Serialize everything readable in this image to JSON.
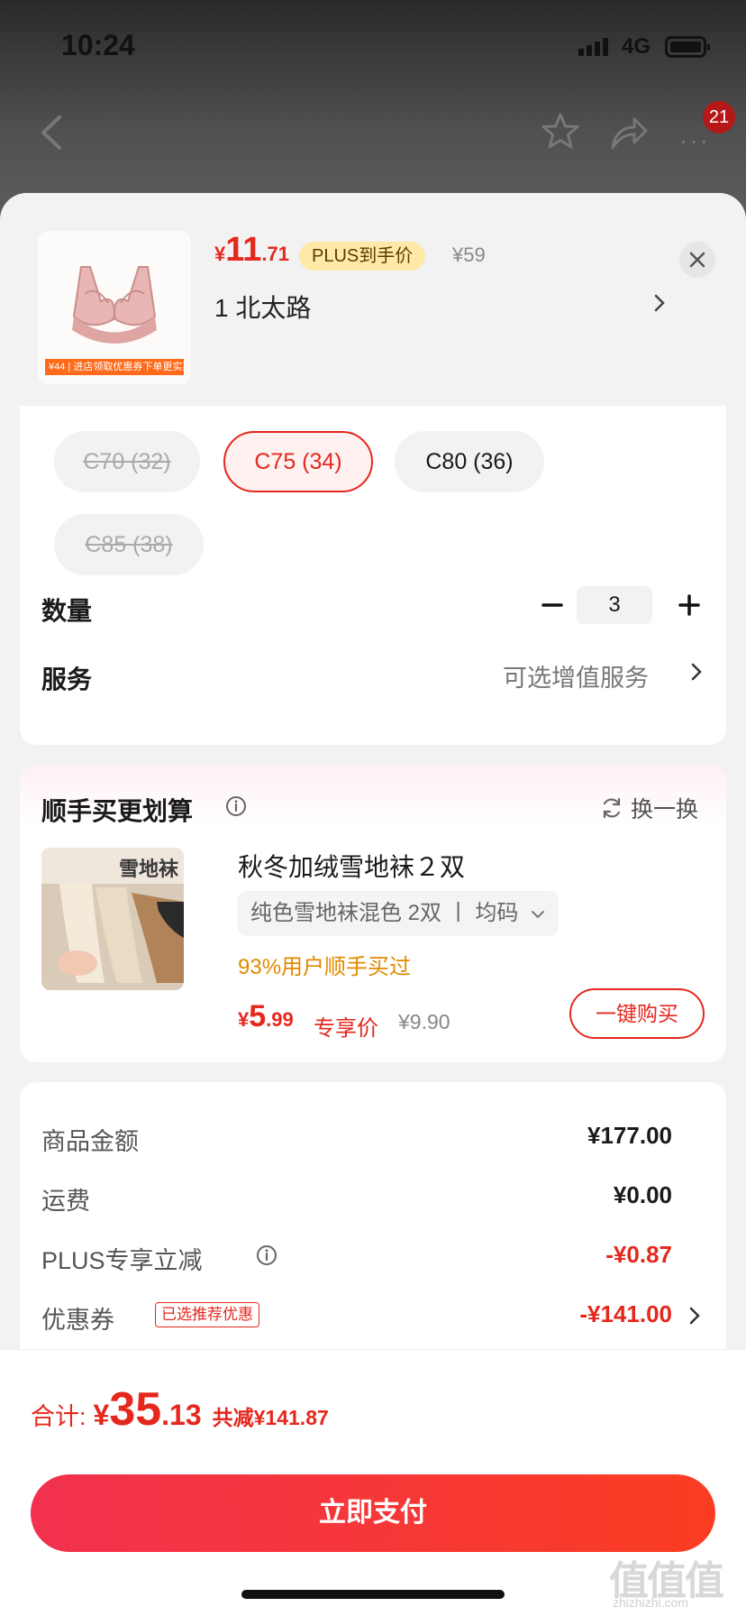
{
  "status": {
    "time": "10:24",
    "network": "4G"
  },
  "nav": {
    "cart_badge": "21"
  },
  "product": {
    "price_yen": "¥",
    "price_int": "11",
    "price_dec": ".71",
    "plus_badge": "PLUS到手价",
    "original_price": "¥59",
    "selected_variant": "1  北太路",
    "thumb_strip_text": "¥44 | 进店领取优惠券下单更实惠"
  },
  "sizes": [
    {
      "label": "C70 (32)",
      "state": "disabled"
    },
    {
      "label": "C75 (34)",
      "state": "selected"
    },
    {
      "label": "C80 (36)",
      "state": "available"
    },
    {
      "label": "C85 (38)",
      "state": "disabled"
    }
  ],
  "quantity": {
    "label": "数量",
    "value": "3"
  },
  "service": {
    "label": "服务",
    "value": "可选增值服务"
  },
  "bundle": {
    "title": "顺手买更划算",
    "refresh_label": "换一换",
    "image_caption": "雪地袜",
    "name": "秋冬加绒雪地袜２双",
    "spec": "纯色雪地袜混色 2双  丨  均码",
    "percent_text": "93%用户顺手买过",
    "price_yen": "¥",
    "price_int": "5",
    "price_dec": ".99",
    "price_label": "专享价",
    "original_price": "¥9.90",
    "buy_button": "一键购买"
  },
  "summary": {
    "rows": [
      {
        "label": "商品金额",
        "value": "¥177.00"
      },
      {
        "label": "运费",
        "value": "¥0.00"
      },
      {
        "label": "PLUS专享立减",
        "value": "-¥0.87"
      },
      {
        "label": "优惠券",
        "value": "-¥141.00",
        "tag": "已选推荐优惠"
      }
    ]
  },
  "footer": {
    "total_label": "合计:",
    "total_yen": "¥",
    "total_int": "35",
    "total_dec": ".13",
    "saved_text": "共减¥141.87",
    "pay_button": "立即支付"
  },
  "watermark": {
    "main": "值值值",
    "sub": "zhizhizhi.com"
  },
  "colors": {
    "accent_red": "#e5281e",
    "plus_yellow": "#ffe9a6",
    "orange_text": "#e08a00"
  }
}
